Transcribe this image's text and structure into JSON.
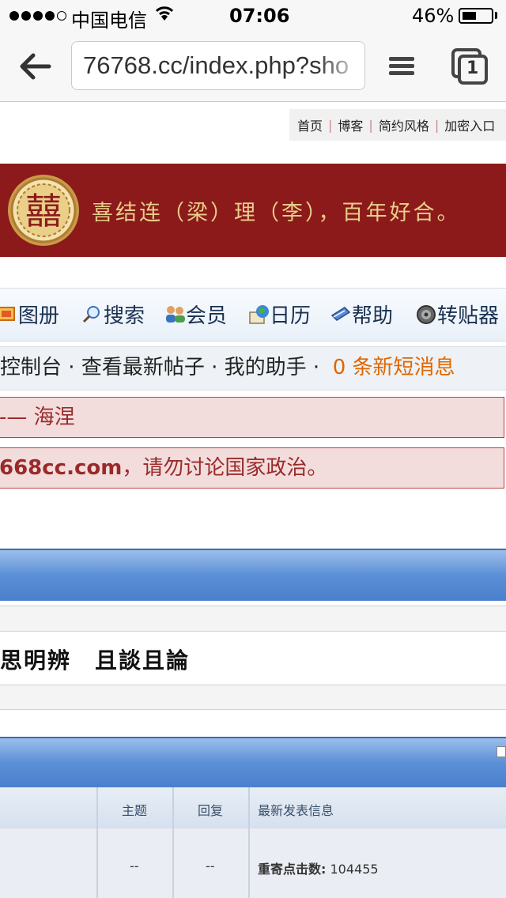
{
  "status_bar": {
    "carrier": "中国电信",
    "time": "07:06",
    "battery": "46%"
  },
  "browser": {
    "url": "76768.cc/index.php?sho",
    "tab_count": "1"
  },
  "top_nav": {
    "items": [
      "首页",
      "博客",
      "简约风格",
      "加密入口"
    ]
  },
  "banner": {
    "emblem_char": "囍",
    "slogan": "喜结连（梁）理（李），百年好合。"
  },
  "menu_bar": {
    "items": [
      {
        "label": "图册",
        "icon": "album-icon"
      },
      {
        "label": "搜索",
        "icon": "search-icon"
      },
      {
        "label": "会员",
        "icon": "members-icon"
      },
      {
        "label": "日历",
        "icon": "calendar-icon"
      },
      {
        "label": "帮助",
        "icon": "help-icon"
      },
      {
        "label": "转贴器",
        "icon": "repost-icon"
      }
    ]
  },
  "control_bar": {
    "console": "控制台",
    "latest": "查看最新帖子",
    "assistant": "我的助手",
    "separator": "·",
    "new_msg_count": "0",
    "new_msg_label": "条新短消息"
  },
  "notices": {
    "line1_prefix": "-—",
    "line1_name": "海涅",
    "line2_domain": "668cc.com",
    "line2_text": "，请勿讨论国家政治。"
  },
  "motto": "思明辨　且談且論",
  "table": {
    "headers": [
      "主题",
      "回复",
      "最新发表信息"
    ],
    "row": {
      "topics": "--",
      "replies": "--",
      "latest_label": "重寄点击数:",
      "latest_value": "104455"
    }
  },
  "colors": {
    "banner_bg": "#8c1a1a",
    "banner_text": "#e8cf8c",
    "accent_orange": "#e06600",
    "notice_text": "#9a2a2a",
    "blue_bar": "#5b8fd6"
  }
}
